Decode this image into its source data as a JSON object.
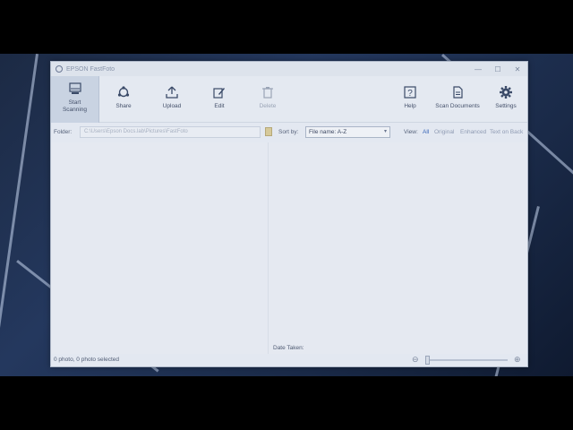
{
  "window": {
    "title": "EPSON FastFoto",
    "controls": {
      "minimize": "—",
      "maximize": "☐",
      "close": "✕"
    }
  },
  "toolbar": {
    "start_scanning": "Start Scanning",
    "share": "Share",
    "upload": "Upload",
    "edit": "Edit",
    "delete": "Delete",
    "help": "Help",
    "scan_documents": "Scan Documents",
    "settings": "Settings"
  },
  "options": {
    "folder_label": "Folder:",
    "folder_path": "C:\\Users\\Epson Docs.lab\\Pictures\\FastFoto",
    "sort_label": "Sort by:",
    "sort_value": "File name: A-Z",
    "view_label": "View:",
    "view_options": [
      "All",
      "Original",
      "Enhanced",
      "Text on Back"
    ]
  },
  "content": {
    "date_taken_label": "Date Taken:"
  },
  "status": {
    "selection_text": "0 photo, 0 photo selected"
  },
  "icons": {
    "start_scanning": "scanner-icon",
    "share": "share-icon",
    "upload": "upload-icon",
    "edit": "edit-icon",
    "delete": "trash-icon",
    "help": "help-icon",
    "scan_documents": "document-icon",
    "settings": "gear-icon"
  },
  "colors": {
    "accent": "#3866b8",
    "window_bg": "#e3e8f1",
    "toolbar_active": "#c9d3e2"
  }
}
